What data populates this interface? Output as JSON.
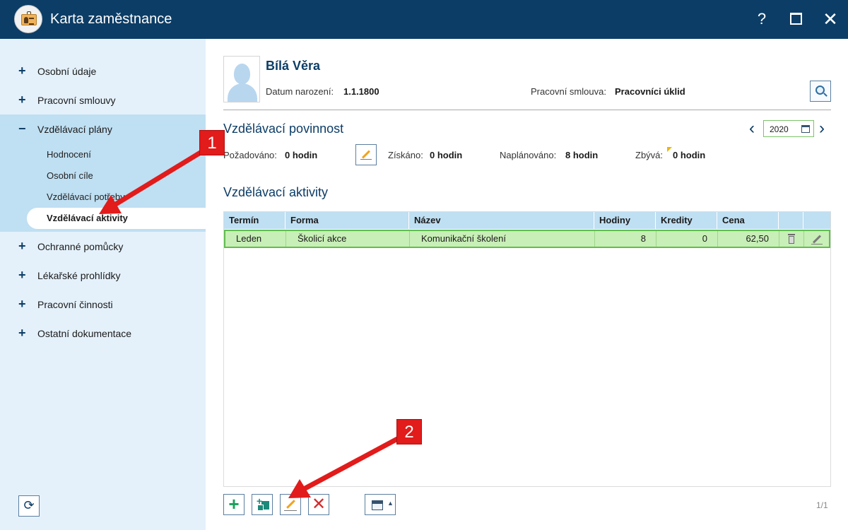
{
  "window": {
    "title": "Karta zaměstnance",
    "help": "?",
    "close": "✕"
  },
  "sidebar": {
    "items": [
      {
        "sign": "+",
        "label": "Osobní údaje"
      },
      {
        "sign": "+",
        "label": "Pracovní smlouvy"
      },
      {
        "sign": "−",
        "label": "Vzdělávací plány"
      },
      {
        "sign": "+",
        "label": "Ochranné pomůcky"
      },
      {
        "sign": "+",
        "label": "Lékařské prohlídky"
      },
      {
        "sign": "+",
        "label": "Pracovní činnosti"
      },
      {
        "sign": "+",
        "label": "Ostatní dokumentace"
      }
    ],
    "subitems": [
      "Hodnocení",
      "Osobní cíle",
      "Vzdělávací potřeby"
    ],
    "active_subitem": "Vzdělávací aktivity",
    "refresh": "⟳"
  },
  "employee": {
    "name": "Bílá Věra",
    "dob_label": "Datum narození:",
    "dob_value": "1.1.1800",
    "contract_label": "Pracovní smlouva:",
    "contract_value": "Pracovníci úklid"
  },
  "duty": {
    "title": "Vzdělávací povinnost",
    "year": "2020",
    "prev": "‹",
    "next": "›",
    "required_label": "Požadováno:",
    "required_value": "0 hodin",
    "gained_label": "Získáno:",
    "gained_value": "0 hodin",
    "planned_label": "Naplánováno:",
    "planned_value": "8 hodin",
    "remaining_label": "Zbývá:",
    "remaining_value": "0 hodin"
  },
  "activities": {
    "title": "Vzdělávací aktivity",
    "columns": [
      "Termín",
      "Forma",
      "Název",
      "Hodiny",
      "Kredity",
      "Cena"
    ],
    "rows": [
      {
        "termin": "Leden",
        "forma": "Školicí akce",
        "nazev": "Komunikační školení",
        "hodiny": "8",
        "kredity": "0",
        "cena": "62,50"
      }
    ],
    "page": "1/1"
  },
  "toolbar": {
    "add": "+",
    "delete": "✕"
  },
  "callouts": [
    "1",
    "2"
  ],
  "colors": {
    "titlebar": "#0c3d66",
    "sidebar": "#e4f1fb",
    "selected_group": "#bfdff2",
    "row_highlight": "#c8efb7",
    "callout": "#e21b1b"
  }
}
